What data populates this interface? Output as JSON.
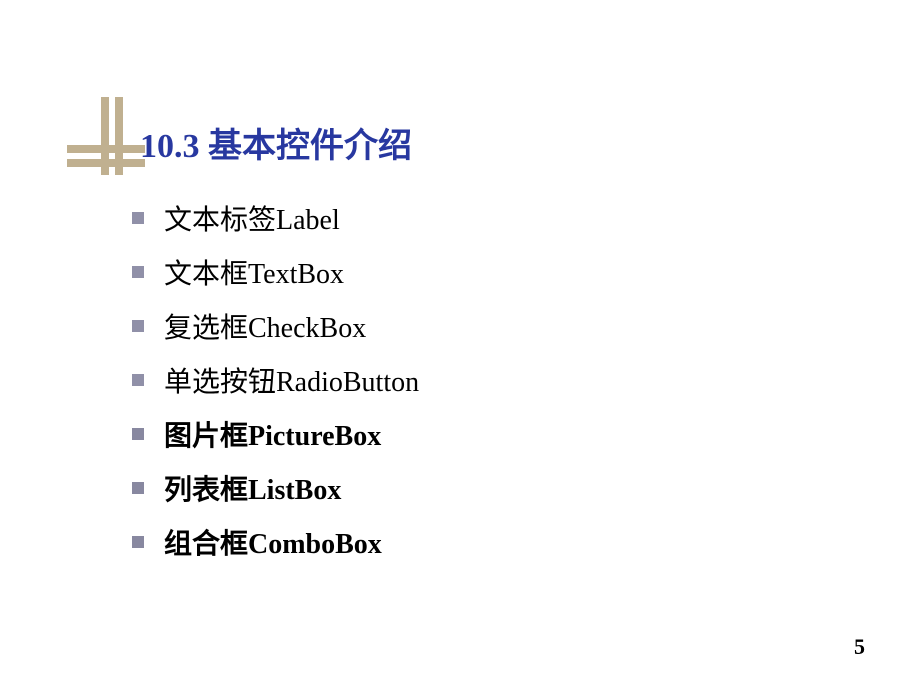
{
  "slide": {
    "title": "10.3 基本控件介绍",
    "bullets": [
      {
        "text": "文本标签Label",
        "bold": false
      },
      {
        "text": "文本框TextBox",
        "bold": false
      },
      {
        "text": "复选框CheckBox",
        "bold": false
      },
      {
        "text": "单选按钮RadioButton",
        "bold": false
      },
      {
        "text": "图片框PictureBox",
        "bold": true
      },
      {
        "text": "列表框ListBox",
        "bold": true
      },
      {
        "text": "组合框ComboBox",
        "bold": true
      }
    ],
    "pageNumber": "5"
  }
}
